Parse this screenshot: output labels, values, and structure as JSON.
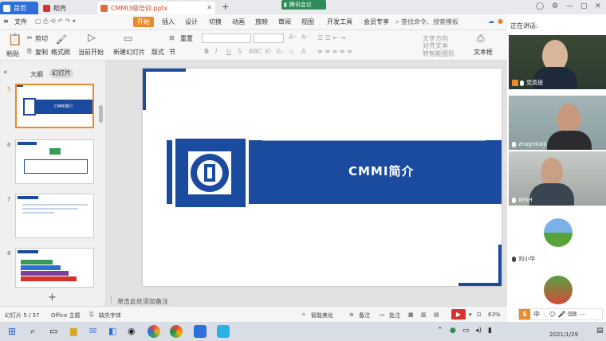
{
  "tabs": {
    "home": "首页",
    "docer": "稻壳",
    "ppt": "CMMI3级培训.pptx",
    "add": "+"
  },
  "meeting": {
    "label": "腾讯会议"
  },
  "menu": {
    "file": "文件",
    "items": [
      "开始",
      "插入",
      "设计",
      "切换",
      "动画",
      "放映",
      "审阅",
      "视图",
      "开发工具",
      "会员专享"
    ],
    "search": "查找命令、搜索模板"
  },
  "ribbon": {
    "paste": "粘贴",
    "cut": "剪切",
    "copy": "复制",
    "format_painter": "格式刷",
    "from_start": "当前开始",
    "new_slide": "新建幻灯片",
    "layout": "版式",
    "section": "节",
    "reset": "重置",
    "text_direction": "文字方向",
    "align_text": "对齐文本",
    "convert_smartart": "转智能图形",
    "text_box": "文本框"
  },
  "left_pane": {
    "outline": "大纲",
    "slides": "幻灯片",
    "collapse": "«",
    "add_slide": "+",
    "thumb_numbers": [
      "5",
      "6",
      "7",
      "8"
    ]
  },
  "slide": {
    "title": "CMMI简介",
    "thumb_title": "CMMI简介"
  },
  "notes": {
    "placeholder": "单击此处添加备注"
  },
  "status": {
    "slide_count": "幻灯片 5 / 37",
    "theme": "Office 主题",
    "missing_font": "缺失字体",
    "beautify": "智能美化",
    "notes": "备注",
    "comments": "批注",
    "zoom": "63%"
  },
  "video": {
    "speaking_label": "正在讲话:",
    "participants": [
      "党真珉",
      "zhagnkaiji",
      "WGH",
      "刘小华",
      ""
    ]
  },
  "taskbar": {
    "ime": "中",
    "time": "2021/1/29"
  },
  "colors": {
    "brand_blue": "#1a4b9e",
    "accent_orange": "#e98a2c",
    "wps_blue": "#2e6fd8"
  }
}
